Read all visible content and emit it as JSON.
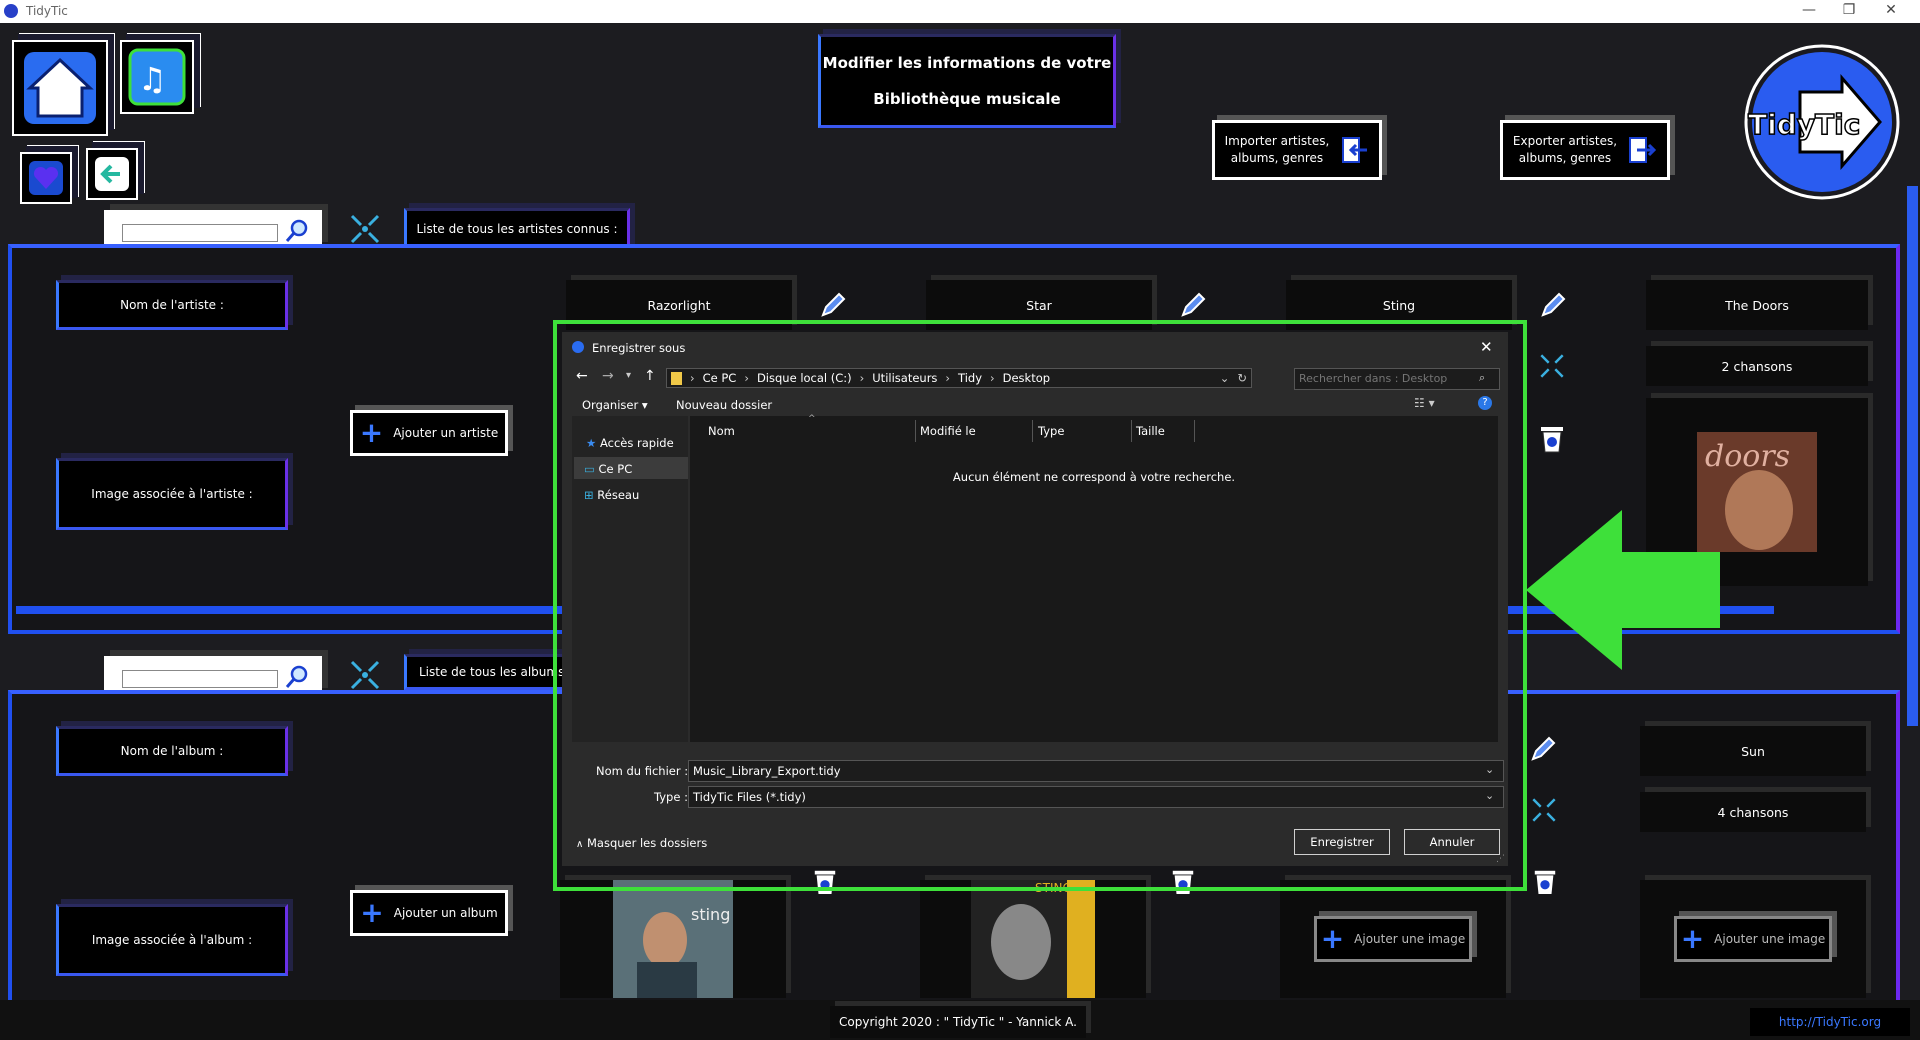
{
  "window": {
    "title": "TidyTic"
  },
  "header": {
    "page_title_line1": "Modifier les informations de votre",
    "page_title_line2": "Bibliothèque musicale",
    "import_label_line1": "Importer artistes,",
    "import_label_line2": "albums, genres",
    "export_label_line1": "Exporter artistes,",
    "export_label_line2": "albums, genres",
    "logo_text": "TidyTic"
  },
  "artists_section": {
    "list_header": "Liste de tous les artistes connus :",
    "name_label": "Nom de l'artiste :",
    "image_label": "Image associée à l'artiste :",
    "add_button": "Ajouter un artiste",
    "cards": [
      {
        "name": "Razorlight"
      },
      {
        "name": "Star"
      },
      {
        "name": "Sting"
      },
      {
        "name": "The Doors",
        "songs": "2 chansons"
      }
    ]
  },
  "albums_section": {
    "list_header": "Liste de tous les albums c",
    "name_label": "Nom de l'album :",
    "image_label": "Image associée à l'album :",
    "add_button": "Ajouter un album",
    "add_image_label": "Ajouter une image",
    "last_card": {
      "name": "Sun",
      "songs": "4 chansons"
    }
  },
  "footer": {
    "copyright": "Copyright 2020 : \" TidyTic \" - Yannick A.",
    "link": "http://TidyTic.org"
  },
  "save_dialog": {
    "title": "Enregistrer sous",
    "breadcrumb": [
      "Ce PC",
      "Disque local (C:)",
      "Utilisateurs",
      "Tidy",
      "Desktop"
    ],
    "search_placeholder": "Rechercher dans : Desktop",
    "organize": "Organiser",
    "new_folder": "Nouveau dossier",
    "nav": [
      "Accès rapide",
      "Ce PC",
      "Réseau"
    ],
    "columns": [
      "Nom",
      "Modifié le",
      "Type",
      "Taille"
    ],
    "empty_message": "Aucun élément ne correspond à votre recherche.",
    "filename_label": "Nom du fichier :",
    "filename_value": "Music_Library_Export.tidy",
    "type_label": "Type :",
    "type_value": "TidyTic Files (*.tidy)",
    "hide_folders": "Masquer les dossiers",
    "save_button": "Enregistrer",
    "cancel_button": "Annuler"
  },
  "colors": {
    "accent_blue": "#2050f0",
    "accent_purple": "#6c28f0",
    "highlight_green": "#3ee03a"
  },
  "icons": [
    "home-icon",
    "music-edit-icon",
    "heart-icon",
    "back-arrow-icon",
    "search-icon",
    "collapse-icon",
    "pencil-icon",
    "trash-icon",
    "plus-icon",
    "import-icon",
    "export-icon"
  ]
}
